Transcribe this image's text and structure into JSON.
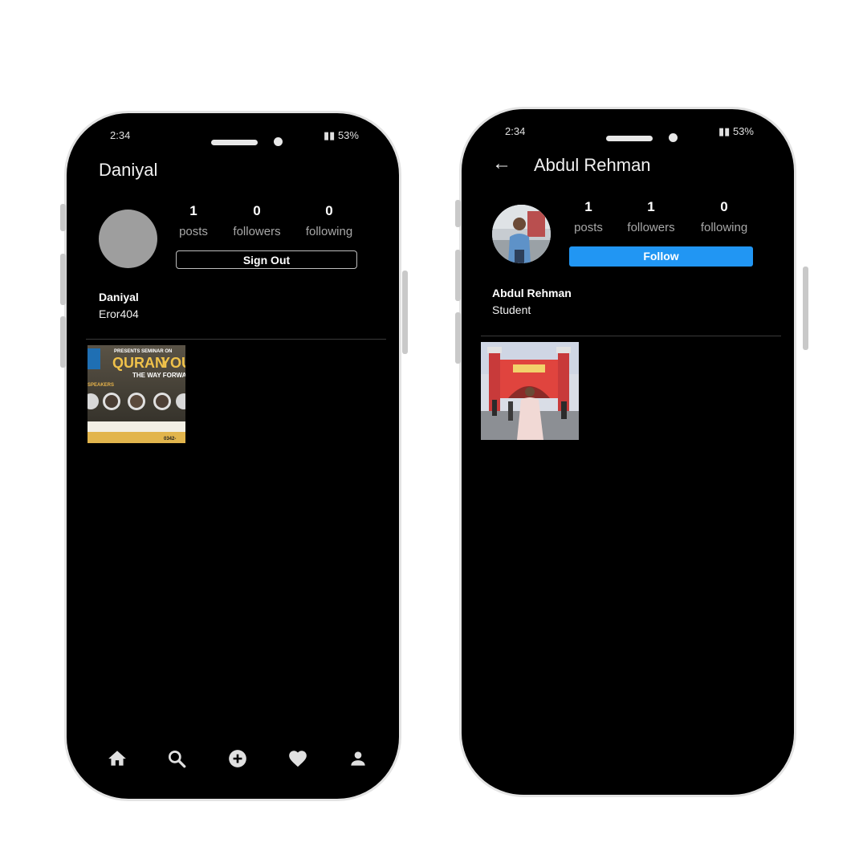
{
  "left_phone": {
    "status": {
      "time": "2:34",
      "battery": "53%"
    },
    "header": {
      "username": "Daniyal"
    },
    "stats": [
      {
        "value": "1",
        "label": "posts"
      },
      {
        "value": "0",
        "label": "followers"
      },
      {
        "value": "0",
        "label": "following"
      }
    ],
    "action_button": "Sign Out",
    "profile": {
      "name": "Daniyal",
      "bio": "Eror404"
    },
    "post_thumbnail": {
      "lines": [
        "PRESENTS SEMINAR ON",
        "QURAN",
        "YOUTH",
        "THE WAY FORWARD",
        "SPEAKERS",
        "0342-"
      ]
    },
    "nav": [
      "home-icon",
      "search-icon",
      "add-post-icon",
      "heart-icon",
      "profile-icon"
    ]
  },
  "right_phone": {
    "status": {
      "time": "2:34",
      "battery": "53%"
    },
    "header": {
      "username": "Abdul Rehman"
    },
    "stats": [
      {
        "value": "1",
        "label": "posts"
      },
      {
        "value": "1",
        "label": "followers"
      },
      {
        "value": "0",
        "label": "following"
      }
    ],
    "action_button": "Follow",
    "profile": {
      "name": "Abdul Rehman",
      "bio": "Student"
    }
  },
  "colors": {
    "background": "#000000",
    "follow_button": "#2196f3",
    "avatar_placeholder": "#9e9e9e"
  }
}
